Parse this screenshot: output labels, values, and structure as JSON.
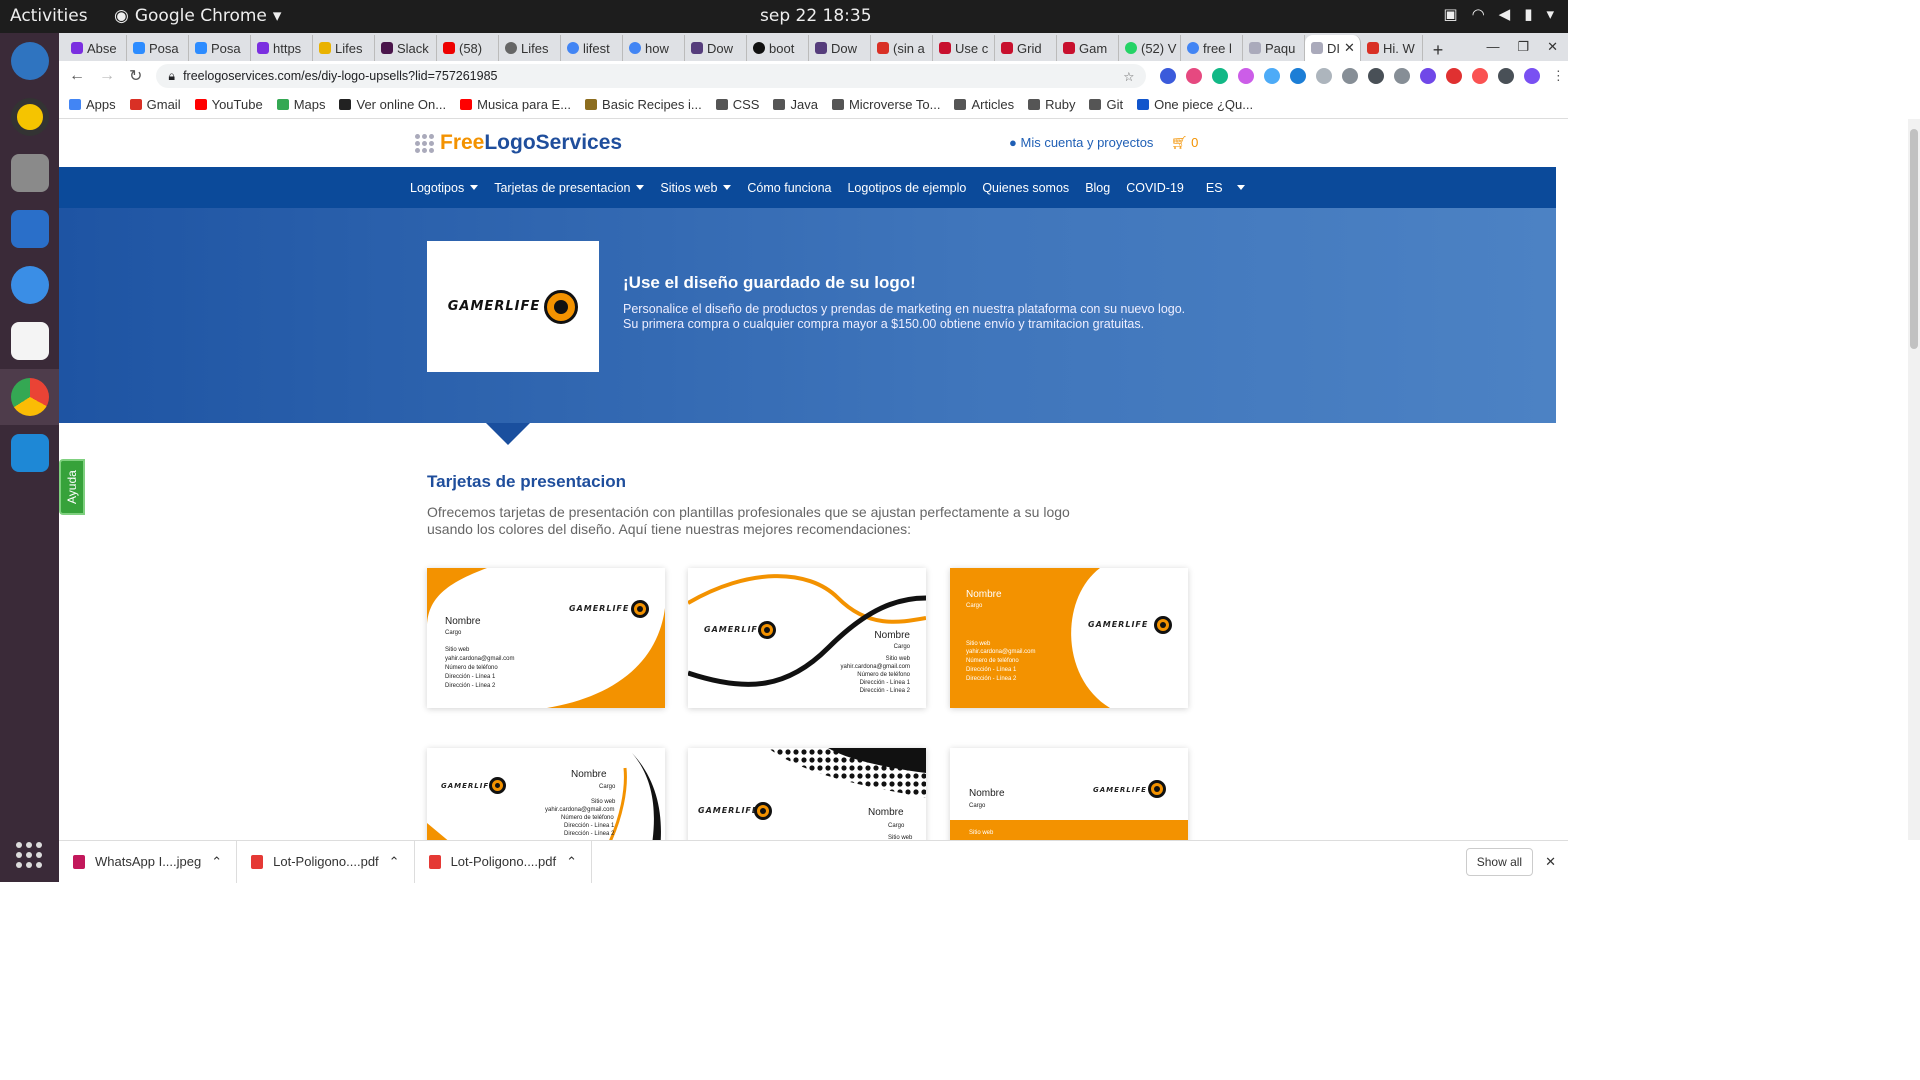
{
  "system": {
    "activities": "Activities",
    "app_name": "Google Chrome",
    "clock": "sep 22  18:35"
  },
  "tabs": [
    "Abse",
    "Posa",
    "Posa",
    "https",
    "Lifes",
    "Slack",
    "(58)",
    "Lifes",
    "lifest",
    "how",
    "Dow",
    "boot",
    "Dow",
    "(sin a",
    "Use c",
    "Grid",
    "Gam",
    "(52) V",
    "free l",
    "Paqu",
    "DI",
    "Hi. W"
  ],
  "address": {
    "url": "freelogoservices.com/es/diy-logo-upsells?lid=757261985"
  },
  "bookmarks": [
    "Apps",
    "Gmail",
    "YouTube",
    "Maps",
    "Ver online On...",
    "Musica para E...",
    "Basic Recipes i...",
    "CSS",
    "Java",
    "Microverse To...",
    "Articles",
    "Ruby",
    "Git",
    "One piece ¿Qu..."
  ],
  "site": {
    "logo_free": "Free",
    "logo_rest": "LogoServices",
    "account": "Mis cuenta y proyectos",
    "cart_count": "0",
    "nav": [
      "Logotipos",
      "Tarjetas de presentacion",
      "Sitios web",
      "Cómo funciona",
      "Logotipos de ejemplo",
      "Quienes somos",
      "Blog",
      "COVID-19",
      "ES"
    ],
    "hero_title": "¡Use el diseño guardado de su logo!",
    "hero_text": "Personalice el diseño de productos y prendas de marketing en nuestra plataforma con su nuevo logo. Su primera compra o cualquier compra mayor a $150.00 obtiene envío y tramitacion gratuitas.",
    "brand": "GAMERLIFE",
    "section_title": "Tarjetas de presentacion",
    "section_text": "Ofrecemos tarjetas de presentación con plantillas profesionales que se ajustan perfectamente a su logo usando los colores del diseño. Aquí tiene nuestras mejores recomendaciones:",
    "help": "Ayuda"
  },
  "card": {
    "name": "Nombre",
    "title": "Cargo",
    "web": "Sitio web",
    "email": "yahir.cardona@gmail.com",
    "phone": "Número de teléfono",
    "addr1": "Dirección - Línea 1",
    "addr2": "Dirección - Línea 2"
  },
  "downloads": [
    "WhatsApp I....jpeg",
    "Lot-Poligono....pdf",
    "Lot-Poligono....pdf"
  ],
  "show_all": "Show all",
  "colors": {
    "accent": "#f39200",
    "nav": "#0b4a9a",
    "brand_blue": "#1f4e9c"
  }
}
